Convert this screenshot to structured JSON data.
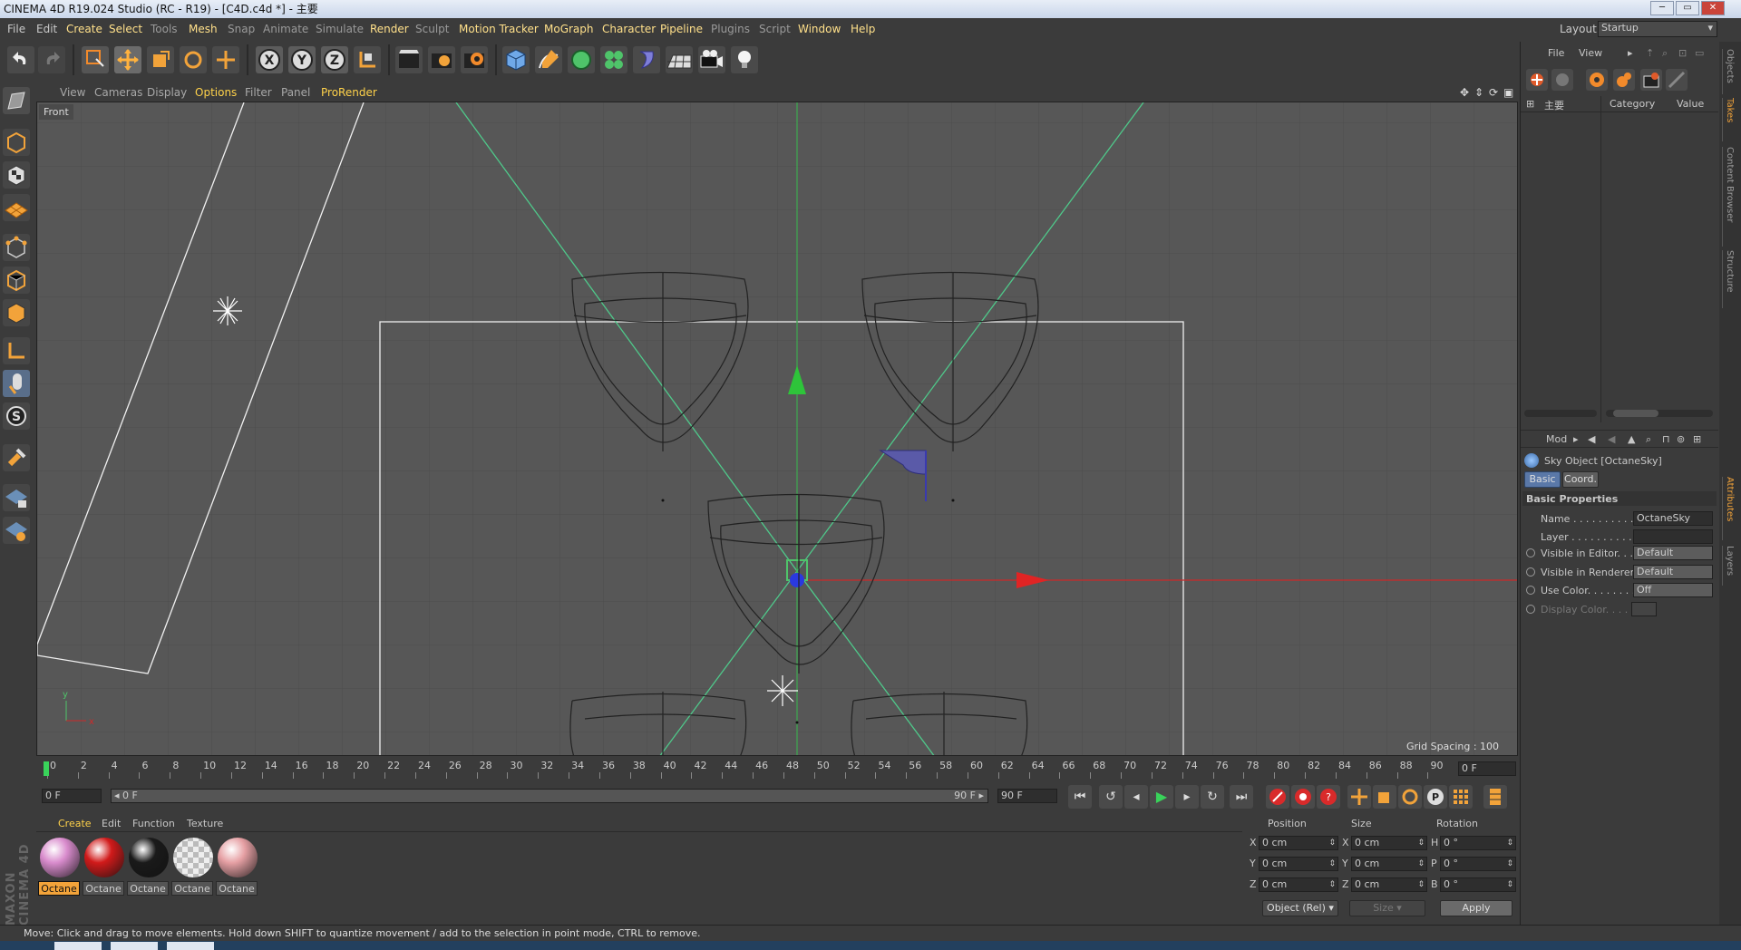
{
  "window": {
    "title": "CINEMA 4D R19.024 Studio (RC - R19) - [C4D.c4d *] - 主要",
    "layout_label": "Layout:",
    "layout_value": "Startup"
  },
  "menubar": {
    "items": [
      "File",
      "Edit",
      "Create",
      "Select",
      "Tools",
      "Mesh",
      "Snap",
      "Animate",
      "Simulate",
      "Render",
      "Sculpt",
      "Motion Tracker",
      "MoGraph",
      "Character",
      "Pipeline",
      "Plugins",
      "Script",
      "Window",
      "Help"
    ]
  },
  "viewport": {
    "menu": [
      "View",
      "Cameras",
      "Display",
      "Options",
      "Filter",
      "Panel",
      "ProRender"
    ],
    "active_menu": "Options",
    "view_name": "Front",
    "grid_spacing": "Grid Spacing : 100 cm",
    "axis_x": "x",
    "axis_y": "y"
  },
  "timeline": {
    "ticks": [
      "0",
      "2",
      "4",
      "6",
      "8",
      "10",
      "12",
      "14",
      "16",
      "18",
      "20",
      "22",
      "24",
      "26",
      "28",
      "30",
      "32",
      "34",
      "36",
      "38",
      "40",
      "42",
      "44",
      "46",
      "48",
      "50",
      "52",
      "54",
      "56",
      "58",
      "60",
      "62",
      "64",
      "66",
      "68",
      "70",
      "72",
      "74",
      "76",
      "78",
      "80",
      "82",
      "84",
      "86",
      "88",
      "90"
    ],
    "current_frame": "0 F",
    "start_field": "0 F",
    "range_start": "◂ 0 F",
    "range_end": "90 F ▸",
    "end_field": "90 F"
  },
  "material_manager": {
    "menu": [
      "Create",
      "Edit",
      "Function",
      "Texture"
    ],
    "materials": [
      {
        "label": "Octane",
        "color": "#d98ccd",
        "selected": true
      },
      {
        "label": "Octane",
        "color": "#d11a1a",
        "selected": false
      },
      {
        "label": "Octane",
        "color": "#1a1a1a",
        "selected": false
      },
      {
        "label": "Octane",
        "color": "checker",
        "selected": false
      },
      {
        "label": "Octane",
        "color": "#e6a0a4",
        "selected": false
      }
    ]
  },
  "coordinates": {
    "headers": [
      "Position",
      "Size",
      "Rotation"
    ],
    "rows": [
      {
        "axis": "X",
        "pos": "0 cm",
        "size_axis": "X",
        "size": "0 cm",
        "rot_axis": "H",
        "rot": "0 °"
      },
      {
        "axis": "Y",
        "pos": "0 cm",
        "size_axis": "Y",
        "size": "0 cm",
        "rot_axis": "P",
        "rot": "0 °"
      },
      {
        "axis": "Z",
        "pos": "0 cm",
        "size_axis": "Z",
        "size": "0 cm",
        "rot_axis": "B",
        "rot": "0 °"
      }
    ],
    "mode_dropdown": "Object (Rel)",
    "size_dropdown": "Size",
    "apply": "Apply"
  },
  "object_manager": {
    "menu": [
      "File",
      "View"
    ],
    "root_label": "主要",
    "columns": [
      "Category",
      "Value"
    ]
  },
  "attributes": {
    "mode": "Mod",
    "object_title": "Sky Object [OctaneSky]",
    "tabs": [
      "Basic",
      "Coord."
    ],
    "active_tab": "Basic",
    "section": "Basic Properties",
    "props": [
      {
        "label": "Name . . . . . . . . . . .",
        "value": "OctaneSky",
        "radio": false
      },
      {
        "label": "Layer . . . . . . . . . . .",
        "value": "",
        "radio": false
      },
      {
        "label": "Visible in Editor. . .",
        "value": "Default",
        "radio": true
      },
      {
        "label": "Visible in Renderer",
        "value": "Default",
        "radio": true
      },
      {
        "label": "Use Color. . . . . . . .",
        "value": "Off",
        "radio": true
      },
      {
        "label": "Display Color. . . .",
        "value": "",
        "radio": true
      }
    ]
  },
  "side_tabs": [
    "Objects",
    "Takes",
    "Content Browser",
    "Structure",
    "Attributes",
    "Layers"
  ],
  "status": "Move: Click and drag to move elements. Hold down SHIFT to quantize movement / add to the selection in point mode, CTRL to remove.",
  "brand": "MAXON CINEMA 4D"
}
